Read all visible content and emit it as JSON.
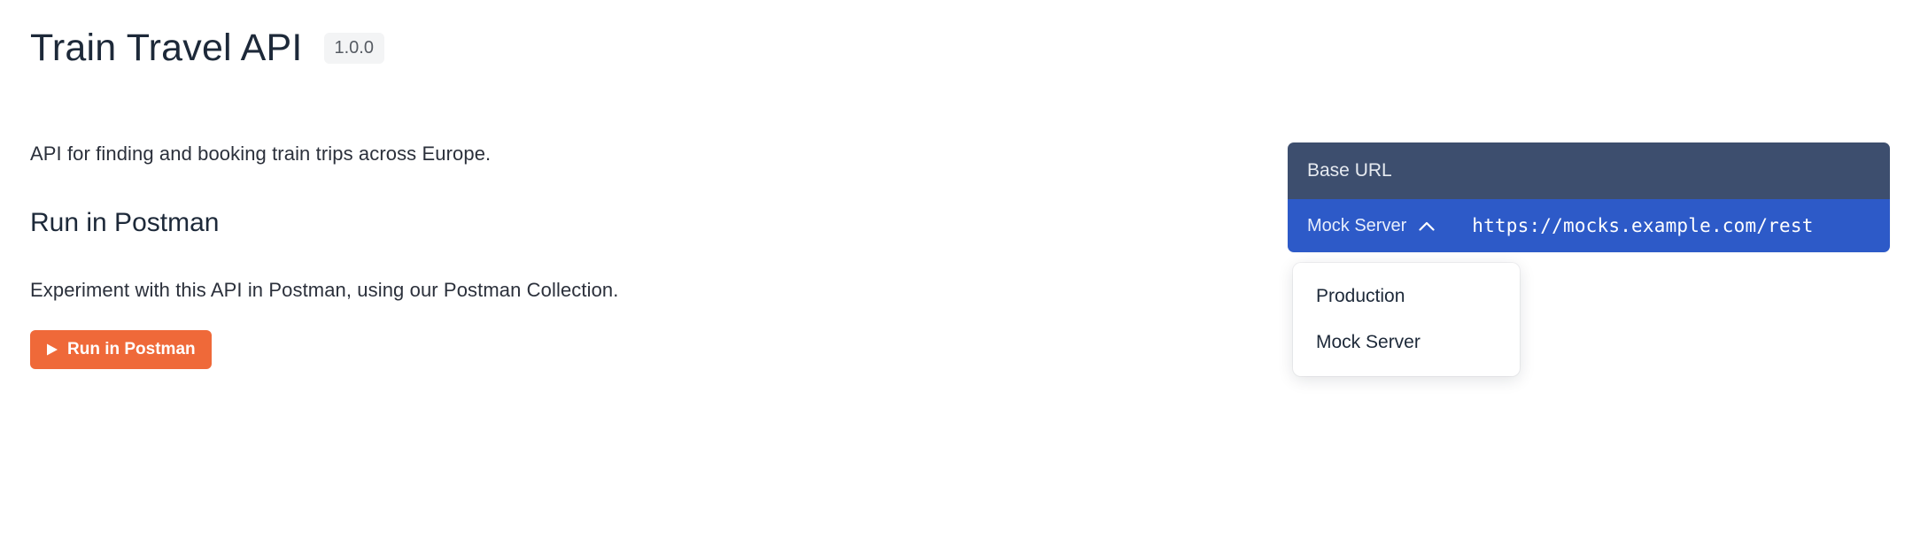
{
  "title": "Train Travel API",
  "version": "1.0.0",
  "description": "API for finding and booking train trips across Europe.",
  "sections": {
    "postman": {
      "heading": "Run in Postman",
      "instructions": "Experiment with this API in Postman, using our Postman Collection.",
      "button_label": "Run in Postman"
    }
  },
  "server_panel": {
    "heading": "Base URL",
    "selected_label": "Mock Server",
    "url": "https://mocks.example.com/rest",
    "options": [
      "Production",
      "Mock Server"
    ]
  }
}
